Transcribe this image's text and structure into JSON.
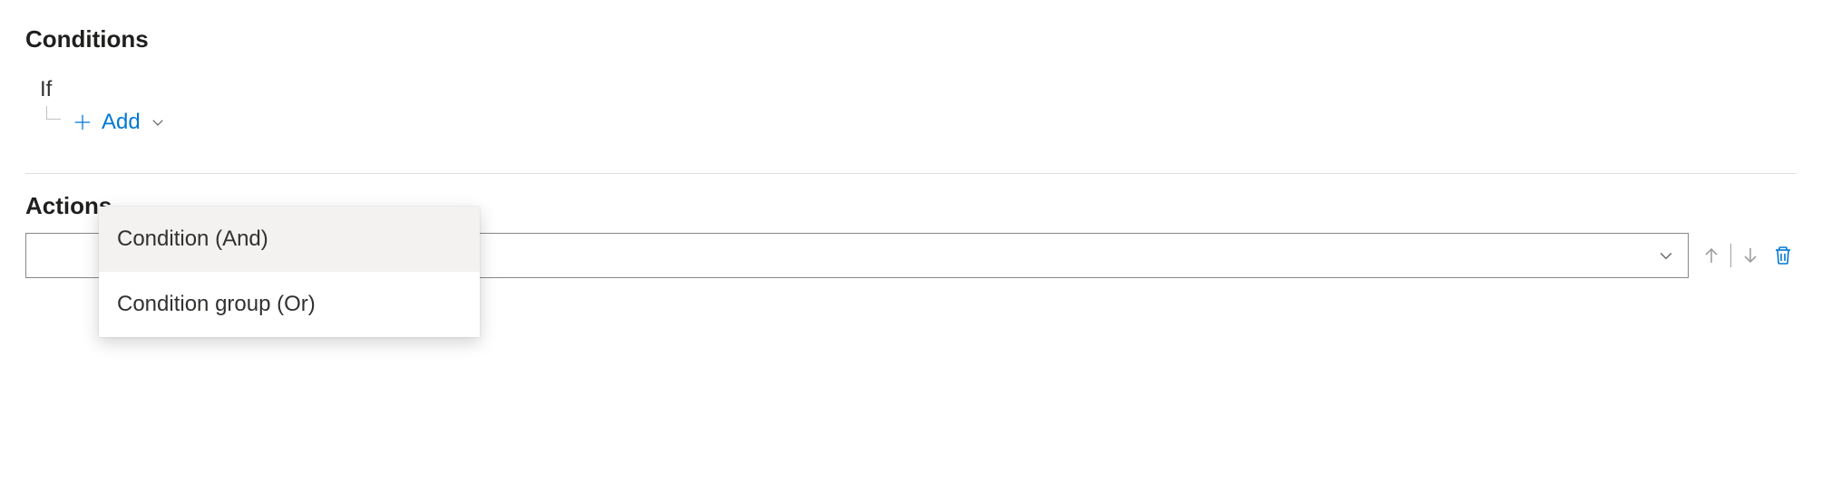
{
  "conditions": {
    "header": "Conditions",
    "if_label": "If",
    "add_label": "Add",
    "menu": {
      "items": [
        {
          "label": "Condition (And)",
          "highlighted": true
        },
        {
          "label": "Condition group (Or)",
          "highlighted": false
        }
      ]
    }
  },
  "actions": {
    "header": "Actions",
    "select_value": ""
  }
}
